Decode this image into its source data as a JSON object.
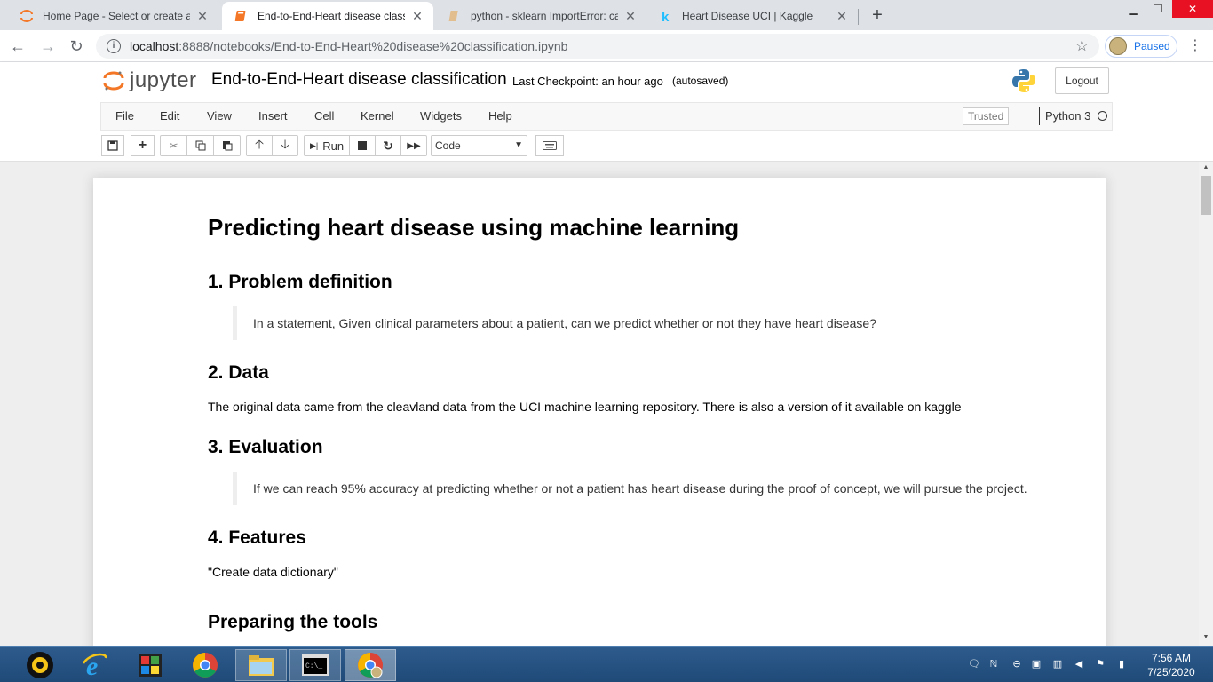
{
  "browser": {
    "tabs": [
      {
        "title": "Home Page - Select or create a n",
        "active": false
      },
      {
        "title": "End-to-End-Heart disease classifi",
        "active": true
      },
      {
        "title": "python - sklearn ImportError: can",
        "active": false
      },
      {
        "title": "Heart Disease UCI | Kaggle",
        "active": false
      }
    ],
    "url_host": "localhost",
    "url_path": ":8888/notebooks/End-to-End-Heart%20disease%20classification.ipynb",
    "profile_label": "Paused"
  },
  "jupyter": {
    "logo_text": "jupyter",
    "notebook_title": "End-to-End-Heart disease classification",
    "checkpoint": "Last Checkpoint: an hour ago",
    "autosave": "(autosaved)",
    "logout_label": "Logout",
    "menu": [
      "File",
      "Edit",
      "View",
      "Insert",
      "Cell",
      "Kernel",
      "Widgets",
      "Help"
    ],
    "trusted_label": "Trusted",
    "kernel_name": "Python 3",
    "run_label": "Run",
    "cell_type": "Code"
  },
  "notebook": {
    "title": "Predicting heart disease using machine learning",
    "sections": [
      {
        "heading": "1. Problem definition",
        "quote": "In a statement, Given clinical parameters about a patient, can we predict whether or not they have heart disease?"
      },
      {
        "heading": "2. Data",
        "text": "The original data came from the cleavland data from the UCI machine learning repository. There is also a version of it available on kaggle"
      },
      {
        "heading": "3. Evaluation",
        "quote": "If we can reach 95% accuracy at predicting whether or not a patient has heart disease during the proof of concept, we will pursue the project."
      },
      {
        "heading": "4. Features",
        "text": "\"Create data dictionary\""
      },
      {
        "heading": "Preparing the tools"
      }
    ]
  },
  "taskbar": {
    "time": "7:56 AM",
    "date": "7/25/2020"
  },
  "colors": {
    "jupyter_orange": "#f37726",
    "chrome_tab_bg": "#dee1e6",
    "taskbar": "#2d5b8c"
  }
}
